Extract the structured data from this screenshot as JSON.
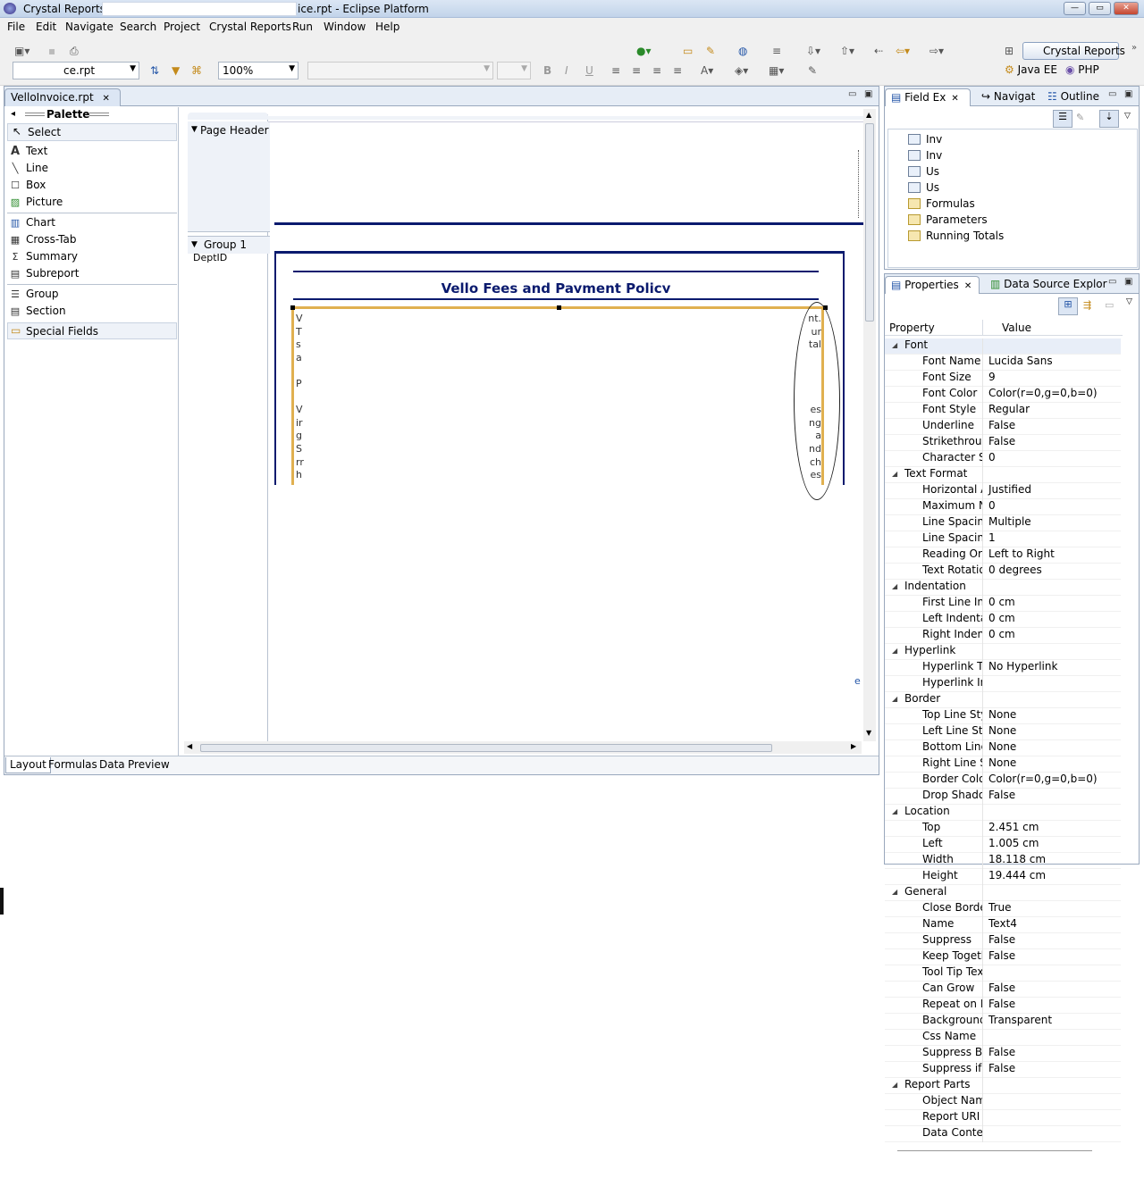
{
  "window": {
    "title_left": "Crystal Reports - ",
    "title_right": "ice.rpt - Eclipse Platform",
    "minimize": "—",
    "maximize": "▭",
    "close": "✕"
  },
  "menu": [
    "File",
    "Edit",
    "Navigate",
    "Search",
    "Project",
    "Crystal Reports",
    "Run",
    "Window",
    "Help"
  ],
  "toolbar": {
    "report_combo": "ce.rpt",
    "zoom_combo": "100%",
    "bold": "B",
    "italic": "I",
    "underline": "U",
    "perspectives": [
      "Crystal Reports",
      "Java EE",
      "PHP"
    ]
  },
  "editor": {
    "tab_label": "VelloInvoice.rpt",
    "palette": {
      "title": "Palette",
      "select": "Select",
      "items": [
        "Text",
        "Line",
        "Box",
        "Picture",
        "Chart",
        "Cross-Tab",
        "Summary",
        "Subreport",
        "Group",
        "Section",
        "Special Fields"
      ]
    },
    "sections": {
      "page_header": "Page Header",
      "group1": "Group 1",
      "group1_field": "DeptID"
    },
    "canvas": {
      "policy_title": "Vello Fees and Payment Policy",
      "left_chars": [
        "V",
        "T",
        "s",
        "a",
        "",
        "P",
        "",
        "V",
        "ir",
        "g",
        "S",
        "rr",
        "h"
      ],
      "right_chars": [
        "nt.",
        "ur",
        "tal",
        "",
        "",
        "",
        "",
        "es",
        "ng",
        "a",
        "nd",
        "ch",
        "es"
      ]
    },
    "bottom_tabs": [
      "Layout",
      "Formulas",
      "Data",
      "Preview"
    ]
  },
  "field_explorer": {
    "tabs": [
      "Field Ex",
      "Navigat",
      "Outline"
    ],
    "items": [
      "Inv",
      "Inv",
      "Us",
      "Us",
      "Formulas",
      "Parameters",
      "Running Totals"
    ]
  },
  "properties": {
    "tabs": [
      "Properties",
      "Data Source Explor"
    ],
    "col_property": "Property",
    "col_value": "Value",
    "rows": [
      {
        "cat": true,
        "k": "Font",
        "v": ""
      },
      {
        "k": "Font Name",
        "v": "Lucida Sans"
      },
      {
        "k": "Font Size",
        "v": "9"
      },
      {
        "k": "Font Color",
        "v": "Color(r=0,g=0,b=0)"
      },
      {
        "k": "Font Style",
        "v": "Regular"
      },
      {
        "k": "Underline",
        "v": "False"
      },
      {
        "k": "Strikethrough",
        "v": "False"
      },
      {
        "k": "Character Sp",
        "v": "0"
      },
      {
        "cat": true,
        "k": "Text Format",
        "v": ""
      },
      {
        "k": "Horizontal Al",
        "v": "Justified"
      },
      {
        "k": "Maximum Nu",
        "v": "0"
      },
      {
        "k": "Line Spacing",
        "v": "Multiple"
      },
      {
        "k": "Line Spacing",
        "v": "1"
      },
      {
        "k": "Reading Ord",
        "v": "Left to Right"
      },
      {
        "k": "Text Rotation",
        "v": "0 degrees"
      },
      {
        "cat": true,
        "k": "Indentation",
        "v": ""
      },
      {
        "k": "First Line Ind",
        "v": "0 cm"
      },
      {
        "k": "Left Indentat",
        "v": "0 cm"
      },
      {
        "k": "Right Indenta",
        "v": "0 cm"
      },
      {
        "cat": true,
        "k": "Hyperlink",
        "v": ""
      },
      {
        "k": "Hyperlink Ty",
        "v": "No Hyperlink"
      },
      {
        "k": "Hyperlink Inf",
        "v": ""
      },
      {
        "cat": true,
        "k": "Border",
        "v": ""
      },
      {
        "k": "Top Line Styl",
        "v": "None"
      },
      {
        "k": "Left Line Styl",
        "v": "None"
      },
      {
        "k": "Bottom Line",
        "v": "None"
      },
      {
        "k": "Right Line Sty",
        "v": "None"
      },
      {
        "k": "Border Color",
        "v": "Color(r=0,g=0,b=0)"
      },
      {
        "k": "Drop Shadow",
        "v": "False"
      },
      {
        "cat": true,
        "k": "Location",
        "v": ""
      },
      {
        "k": "Top",
        "v": "2.451 cm"
      },
      {
        "k": "Left",
        "v": "1.005 cm"
      },
      {
        "k": "Width",
        "v": "18.118 cm"
      },
      {
        "k": "Height",
        "v": "19.444 cm"
      },
      {
        "cat": true,
        "k": "General",
        "v": ""
      },
      {
        "k": "Close Border",
        "v": "True"
      },
      {
        "k": "Name",
        "v": "Text4"
      },
      {
        "k": "Suppress",
        "v": "False"
      },
      {
        "k": "Keep Togeth",
        "v": "False"
      },
      {
        "k": "Tool Tip Text",
        "v": ""
      },
      {
        "k": "Can Grow",
        "v": "False"
      },
      {
        "k": "Repeat on He",
        "v": "False"
      },
      {
        "k": "Background",
        "v": "Transparent"
      },
      {
        "k": "Css Name",
        "v": ""
      },
      {
        "k": "Suppress Bla",
        "v": "False"
      },
      {
        "k": "Suppress if D",
        "v": "False"
      },
      {
        "cat": true,
        "k": "Report Parts",
        "v": ""
      },
      {
        "k": "Object Name",
        "v": ""
      },
      {
        "k": "Report URI",
        "v": ""
      },
      {
        "k": "Data Context",
        "v": ""
      }
    ]
  },
  "colors": {
    "accent_navy": "#0a1a6e",
    "selection_orange": "#e0b050",
    "panel_border": "#99a8bd"
  }
}
